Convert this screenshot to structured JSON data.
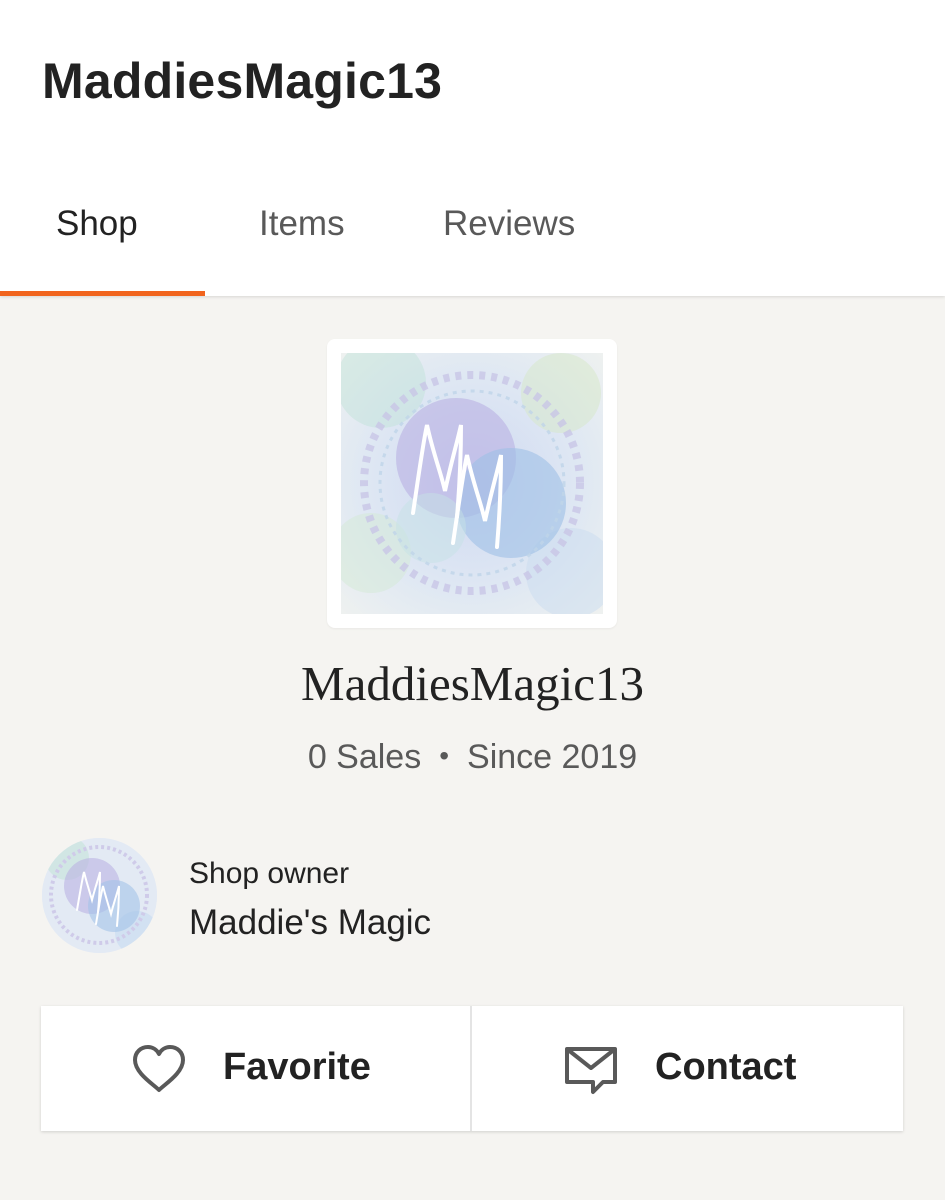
{
  "header": {
    "title": "MaddiesMagic13"
  },
  "tabs": [
    {
      "label": "Shop",
      "active": true
    },
    {
      "label": "Items",
      "active": false
    },
    {
      "label": "Reviews",
      "active": false
    }
  ],
  "shop": {
    "logo_icon": "shop-logo-mm-watercolor",
    "name": "MaddiesMagic13",
    "sales": "0 Sales",
    "separator": "•",
    "since": "Since 2019"
  },
  "owner": {
    "label": "Shop owner",
    "name": "Maddie's Magic",
    "avatar_icon": "owner-avatar-watercolor"
  },
  "actions": {
    "favorite_label": "Favorite",
    "favorite_icon": "heart-outline-icon",
    "contact_label": "Contact",
    "contact_icon": "message-envelope-icon"
  },
  "colors": {
    "accent": "#f1641e",
    "background": "#f5f4f1",
    "text": "#222222",
    "muted_text": "#595959"
  }
}
